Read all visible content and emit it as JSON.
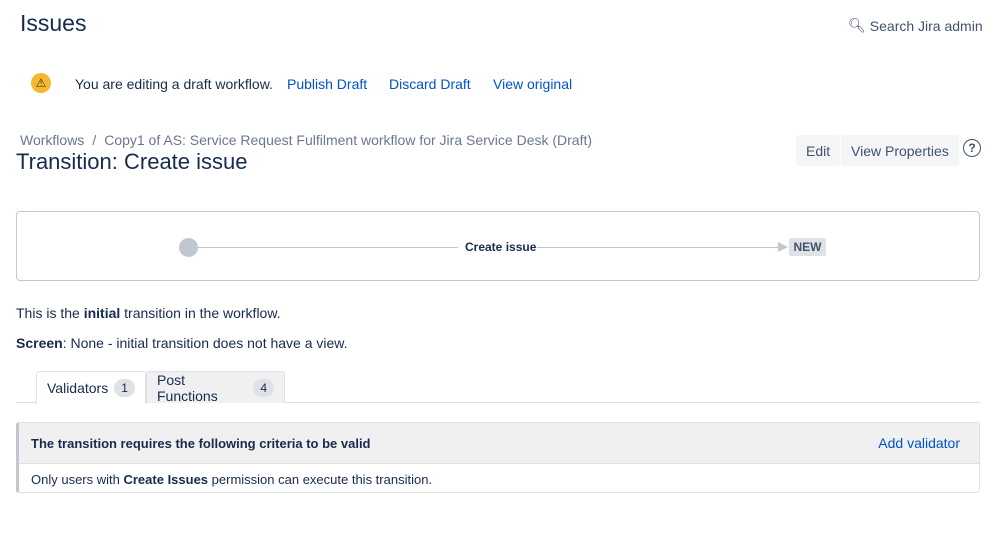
{
  "header": {
    "title": "Issues",
    "search_label": "Search Jira admin"
  },
  "draft": {
    "message": "You are editing a draft workflow.",
    "publish": "Publish Draft",
    "discard": "Discard Draft",
    "view_original": "View original"
  },
  "breadcrumb": {
    "root": "Workflows",
    "separator": "/",
    "workflow": "Copy1 of AS: Service Request Fulfilment workflow for Jira Service Desk (Draft)"
  },
  "page_title": "Transition: Create issue",
  "actions": {
    "edit": "Edit",
    "view_properties": "View Properties",
    "help": "?"
  },
  "diagram": {
    "transition": "Create issue",
    "target_status": "NEW"
  },
  "info": {
    "line1_pre": "This is the ",
    "line1_bold": "initial",
    "line1_post": " transition in the workflow.",
    "screen_label": "Screen",
    "screen_value": ": None - initial transition does not have a view."
  },
  "tabs": [
    {
      "label": "Validators",
      "count": "1"
    },
    {
      "label": "Post Functions",
      "count": "4"
    }
  ],
  "panel": {
    "header": "The transition requires the following criteria to be valid",
    "add": "Add validator",
    "body_pre": "Only users with ",
    "body_bold": "Create Issues",
    "body_post": " permission can execute this transition."
  }
}
